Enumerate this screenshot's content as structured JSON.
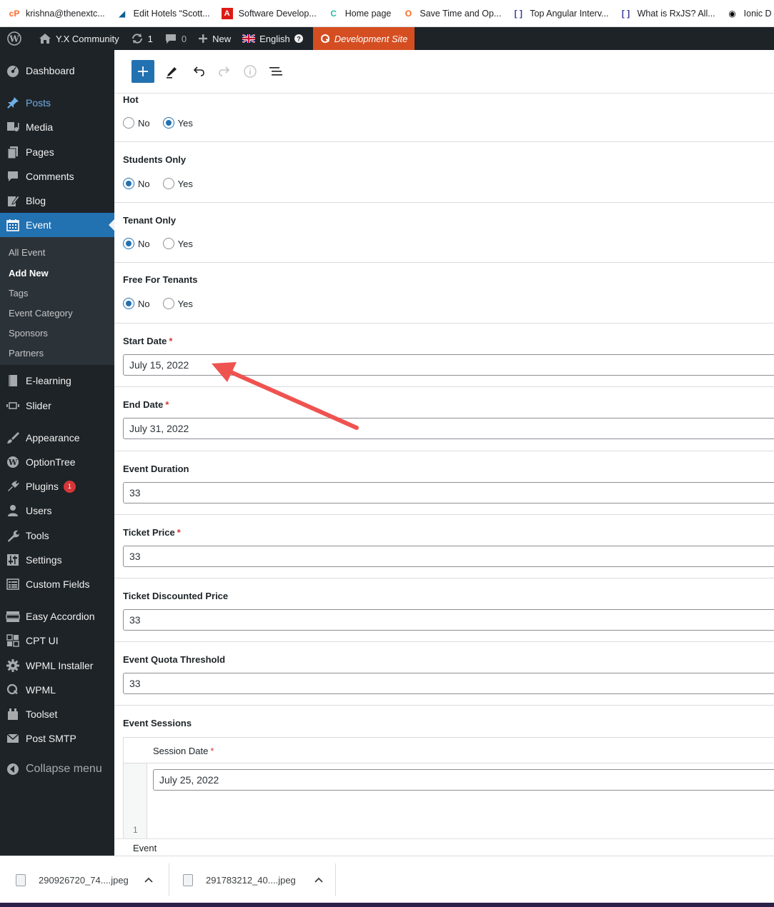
{
  "browser": {
    "bookmarks": [
      {
        "label": "krishna@thenextc...",
        "icon": "cpanel-icon",
        "color": "#ff6c2c"
      },
      {
        "label": "Edit Hotels “Scott...",
        "icon": "hotel-site-icon",
        "color": "#0b5d8f"
      },
      {
        "label": "Software Develop...",
        "icon": "angular-icon",
        "color": "#dd1b16"
      },
      {
        "label": "Home page",
        "icon": "home-page-icon",
        "color": "#2bbbad"
      },
      {
        "label": "Save Time and Op...",
        "icon": "opera-icon",
        "color": "#f26b21"
      },
      {
        "label": "Top Angular Interv...",
        "icon": "bracket-icon",
        "color": "#3b3f99"
      },
      {
        "label": "What is RxJS? All...",
        "icon": "bracket-icon",
        "color": "#3b3f99"
      },
      {
        "label": "Ionic D",
        "icon": "ionic-icon",
        "color": "#000000"
      }
    ]
  },
  "adminbar": {
    "site_name": "Y.X Community",
    "updates_count": "1",
    "comments_count": "0",
    "new_label": "New",
    "language": "English",
    "dev_site": "Development Site"
  },
  "sidebar": {
    "dashboard": "Dashboard",
    "posts": "Posts",
    "media": "Media",
    "pages": "Pages",
    "comments": "Comments",
    "blog": "Blog",
    "event": "Event",
    "event_submenu": {
      "all_event": "All Event",
      "add_new": "Add New",
      "tags": "Tags",
      "event_category": "Event Category",
      "sponsors": "Sponsors",
      "partners": "Partners"
    },
    "elearning": "E-learning",
    "slider": "Slider",
    "appearance": "Appearance",
    "optiontree": "OptionTree",
    "plugins": "Plugins",
    "plugins_badge": "1",
    "users": "Users",
    "tools": "Tools",
    "settings": "Settings",
    "custom_fields": "Custom Fields",
    "easy_accordion": "Easy Accordion",
    "cpt_ui": "CPT UI",
    "wpml_installer": "WPML Installer",
    "wpml": "WPML",
    "toolset": "Toolset",
    "post_smtp": "Post SMTP",
    "collapse": "Collapse menu"
  },
  "form": {
    "hot": {
      "label": "Hot",
      "no": "No",
      "yes": "Yes",
      "selected": "Yes"
    },
    "students_only": {
      "label": "Students Only",
      "no": "No",
      "yes": "Yes",
      "selected": "No"
    },
    "tenant_only": {
      "label": "Tenant Only",
      "no": "No",
      "yes": "Yes",
      "selected": "No"
    },
    "free_for_tenants": {
      "label": "Free For Tenants",
      "no": "No",
      "yes": "Yes",
      "selected": "No"
    },
    "start_date": {
      "label": "Start Date",
      "required": "*",
      "value": "July 15, 2022"
    },
    "end_date": {
      "label": "End Date",
      "required": "*",
      "value": "July 31, 2022"
    },
    "event_duration": {
      "label": "Event Duration",
      "value": "33"
    },
    "ticket_price": {
      "label": "Ticket Price",
      "required": "*",
      "value": "33"
    },
    "ticket_discounted_price": {
      "label": "Ticket Discounted Price",
      "value": "33"
    },
    "event_quota_threshold": {
      "label": "Event Quota Threshold",
      "value": "33"
    },
    "event_sessions": {
      "label": "Event Sessions",
      "session_date_label": "Session Date",
      "required": "*",
      "row_number": "1",
      "session_date_value": "July 25, 2022"
    }
  },
  "footer": {
    "breadcrumb": "Event"
  },
  "downloads": [
    {
      "filename": "290926720_74....jpeg"
    },
    {
      "filename": "291783212_40....jpeg"
    }
  ],
  "annotation": {
    "arrow_color": "#ef5350"
  }
}
